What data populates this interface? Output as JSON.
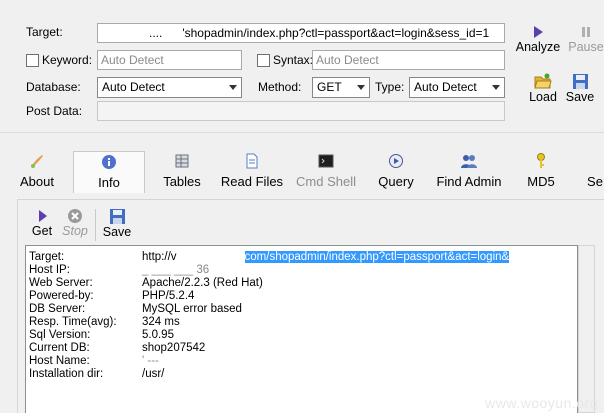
{
  "form": {
    "target_label": "Target:",
    "target_value_prefix": "....",
    "target_value": "'shopadmin/index.php?ctl=passport&act=login&sess_id=1",
    "keyword_label": "Keyword:",
    "keyword_placeholder": "Auto Detect",
    "syntax_label": "Syntax:",
    "syntax_placeholder": "Auto Detect",
    "database_label": "Database:",
    "database_value": "Auto Detect",
    "method_label": "Method:",
    "method_value": "GET",
    "type_label": "Type:",
    "type_value": "Auto Detect",
    "postdata_label": "Post Data:",
    "postdata_value": ""
  },
  "right_buttons": {
    "analyze": "Analyze",
    "pause": "Pause",
    "load": "Load",
    "save": "Save"
  },
  "tabs": [
    {
      "label": "About",
      "icon": "brush-icon"
    },
    {
      "label": "Info",
      "icon": "info-icon"
    },
    {
      "label": "Tables",
      "icon": "table-icon"
    },
    {
      "label": "Read Files",
      "icon": "file-icon"
    },
    {
      "label": "Cmd Shell",
      "icon": "terminal-icon"
    },
    {
      "label": "Query",
      "icon": "query-icon"
    },
    {
      "label": "Find Admin",
      "icon": "users-icon"
    },
    {
      "label": "MD5",
      "icon": "key-icon"
    },
    {
      "label": "Se",
      "icon": ""
    }
  ],
  "panel_toolbar": {
    "get": "Get",
    "stop": "Stop",
    "save": "Save"
  },
  "info": [
    {
      "key": "Target:",
      "value": "http://v",
      "value_tail": "com/shopadmin/index.php?ctl=passport&act=login&"
    },
    {
      "key": "Host IP:",
      "value": "_ ___ ___ 36"
    },
    {
      "key": "Web Server:",
      "value": "Apache/2.2.3 (Red Hat)"
    },
    {
      "key": "Powered-by:",
      "value": "PHP/5.2.4"
    },
    {
      "key": "DB Server:",
      "value": "MySQL error based"
    },
    {
      "key": "Resp. Time(avg):",
      "value": "324 ms"
    },
    {
      "key": "Sql Version:",
      "value": "5.0.95"
    },
    {
      "key": "Current DB:",
      "value": "shop207542"
    },
    {
      "key": "Host Name:",
      "value": "' ---"
    },
    {
      "key": "Installation dir:",
      "value": "/usr/"
    }
  ],
  "watermark": "www.wooyun.org",
  "colors": {
    "selection": "#3399ff",
    "window_bg": "#f0f0f0",
    "accent_purple": "#5b3fb0"
  }
}
